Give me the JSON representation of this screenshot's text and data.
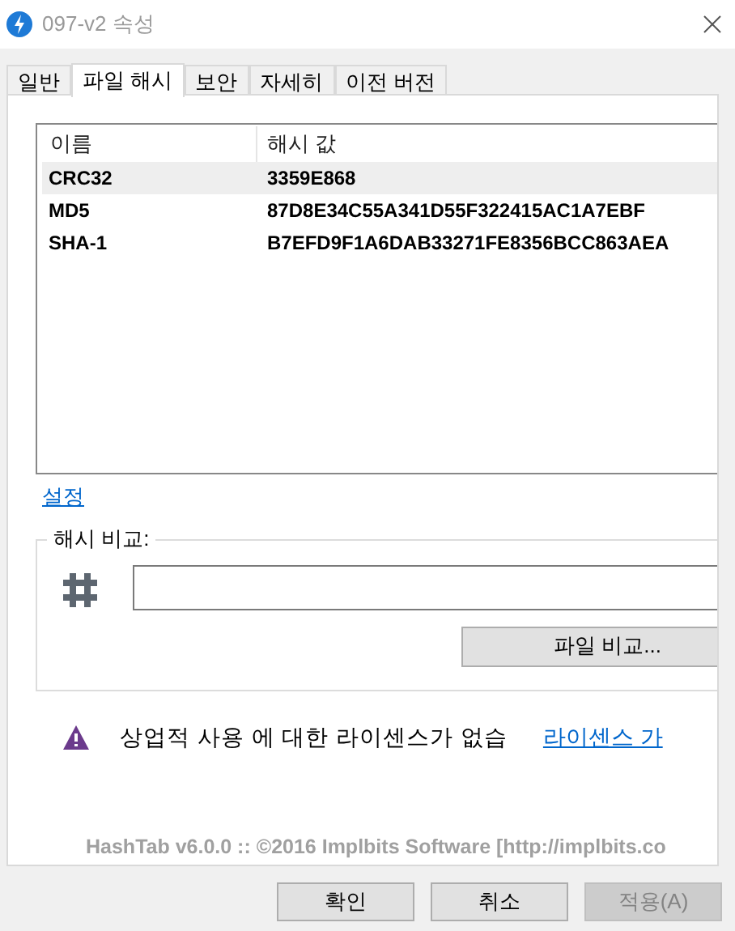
{
  "window": {
    "title": "097-v2 속성"
  },
  "tabs": [
    {
      "label": "일반",
      "selected": false
    },
    {
      "label": "파일 해시",
      "selected": true
    },
    {
      "label": "보안",
      "selected": false
    },
    {
      "label": "자세히",
      "selected": false
    },
    {
      "label": "이전 버전",
      "selected": false
    }
  ],
  "hash_list": {
    "columns": [
      "이름",
      "해시 값"
    ],
    "rows": [
      {
        "name": "CRC32",
        "value": "3359E868",
        "selected": true
      },
      {
        "name": "MD5",
        "value": "87D8E34C55A341D55F322415AC1A7EBF",
        "selected": false
      },
      {
        "name": "SHA-1",
        "value": "B7EFD9F1A6DAB33271FE8356BCC863AEA",
        "selected": false
      }
    ]
  },
  "settings_link": "설정",
  "hash_compare": {
    "label": "해시 비교:",
    "compare_button": "파일 비교..."
  },
  "license_notice": {
    "text": "상업적 사용 에 대한 라이센스가 없습",
    "link": "라이센스 가"
  },
  "footer": "HashTab v6.0.0 :: ©2016 Implbits Software [http://implbits.co",
  "buttons": [
    {
      "label": "확인",
      "disabled": false
    },
    {
      "label": "취소",
      "disabled": false
    },
    {
      "label": "적용(A)",
      "disabled": true
    }
  ]
}
